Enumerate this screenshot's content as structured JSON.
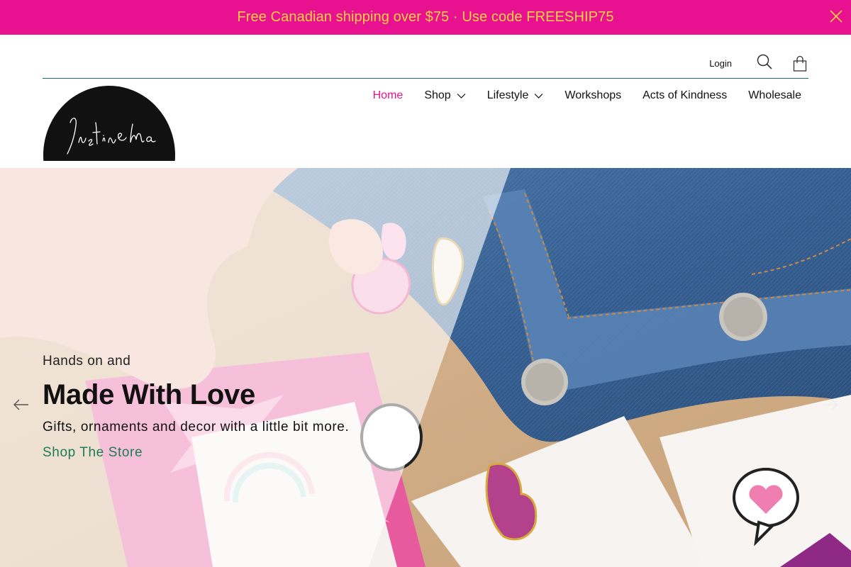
{
  "announcement": {
    "text": "Free Canadian shipping over $75 · Use code FREESHIP75",
    "close_icon": "close-icon"
  },
  "header": {
    "login_label": "Login",
    "search_icon": "search-icon",
    "cart_icon": "shopping-bag-icon"
  },
  "logo": {
    "text": "Justine Ma"
  },
  "nav": {
    "items": [
      {
        "label": "Home",
        "active": true,
        "dropdown": false
      },
      {
        "label": "Shop",
        "active": false,
        "dropdown": true
      },
      {
        "label": "Lifestyle",
        "active": false,
        "dropdown": true
      },
      {
        "label": "Workshops",
        "active": false,
        "dropdown": false
      },
      {
        "label": "Acts of Kindness",
        "active": false,
        "dropdown": false
      },
      {
        "label": "Wholesale",
        "active": false,
        "dropdown": false
      }
    ]
  },
  "hero": {
    "pretitle": "Hands on and",
    "title": "Made With Love",
    "subtitle": "Gifts, ornaments and decor with a little bit more.",
    "cta_label": "Shop The Store",
    "prev_icon": "arrow-left-icon",
    "next_icon": "arrow-right-icon"
  },
  "colors": {
    "announcement_bg": "#e8118f",
    "announcement_text": "#ffd23f",
    "active_nav": "#e8118f",
    "cta": "#1f7b55",
    "rule": "#1f6e6a"
  }
}
